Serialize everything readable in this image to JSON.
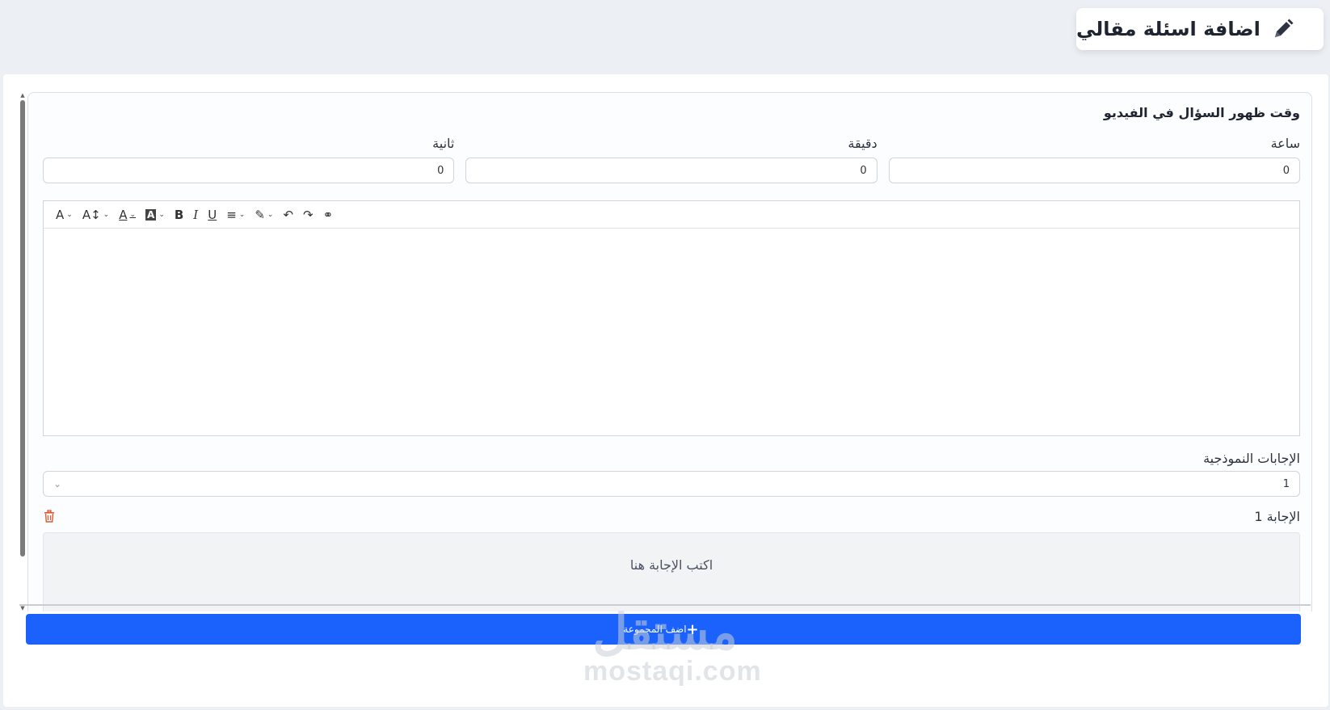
{
  "header": {
    "title": "اضافة اسئلة مقالي",
    "icon": "pencil-icon"
  },
  "question_time": {
    "title": "وقت ظهور السؤال في الفيديو",
    "fields": [
      {
        "label": "ساعة",
        "value": "0"
      },
      {
        "label": "دقيقة",
        "value": "0"
      },
      {
        "label": "ثانية",
        "value": "0"
      }
    ]
  },
  "editor": {
    "toolbar": [
      "font-style",
      "font-size",
      "font-color",
      "highlight-color",
      "bold",
      "italic",
      "underline",
      "align",
      "marker",
      "undo",
      "redo",
      "link"
    ],
    "glyphs": {
      "font_style": "A",
      "font_size": "A↕",
      "font_color": "A",
      "highlight": "A",
      "bold": "B",
      "italic": "I",
      "underline": "U",
      "align": "≡",
      "marker": "✎",
      "undo": "↶",
      "redo": "↷",
      "link": "⚭",
      "caret": "⌄"
    }
  },
  "model_answers": {
    "label": "الإجابات النموذجية",
    "selected": "1"
  },
  "answers": [
    {
      "label": "الإجابة 1",
      "placeholder": "اكتب الإجابة هنا"
    }
  ],
  "add_group_button": {
    "label": "اضف المجموعة",
    "icon": "+"
  },
  "watermark": {
    "arabic": "مستقل",
    "latin": "mostaqi.com"
  },
  "colors": {
    "primary": "#1a62fb",
    "danger": "#e0582e",
    "background": "#ecf0f4"
  }
}
